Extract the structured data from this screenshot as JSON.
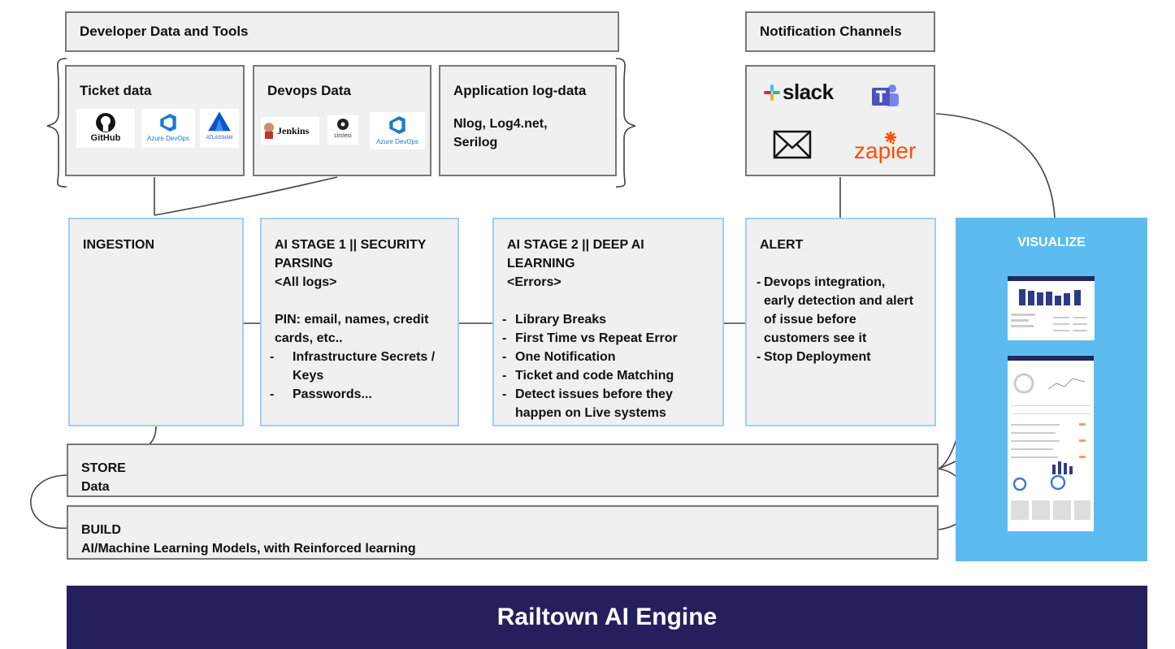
{
  "developer_header": "Developer Data and Tools",
  "notification_header": "Notification Channels",
  "ticket": {
    "title": "Ticket data",
    "logos": [
      "GitHub",
      "Azure DevOps",
      "ATLASSIAN"
    ]
  },
  "devops": {
    "title": "Devops Data",
    "logos": [
      "Jenkins",
      "circleci",
      "Azure DevOps"
    ]
  },
  "applog": {
    "title": "Application log-data",
    "lines": [
      "Nlog, Log4.net,",
      "Serilog"
    ]
  },
  "notifications": {
    "slack": "slack",
    "zapier": "zapier"
  },
  "ingestion": {
    "title": "INGESTION"
  },
  "stage1": {
    "title": "AI STAGE 1 || SECURITY\nPARSING\n<All logs>",
    "pin": "PIN: email, names, credit cards, etc..",
    "items": [
      "Infrastructure Secrets / Keys",
      "Passwords..."
    ]
  },
  "stage2": {
    "title": "AI STAGE 2 || DEEP AI\nLEARNING\n<Errors>",
    "items": [
      "Library Breaks",
      "First Time vs Repeat Error",
      "One Notification",
      "Ticket and code Matching",
      "Detect issues before they happen on Live systems"
    ]
  },
  "alert": {
    "title": "ALERT",
    "items": [
      "Devops integration, early detection and alert of issue before customers see it",
      "Stop Deployment"
    ]
  },
  "visualize": {
    "title": "VISUALIZE"
  },
  "store": {
    "title": "STORE",
    "subtitle": "Data"
  },
  "build": {
    "title": "BUILD",
    "subtitle": "AI/Machine Learning Models, with Reinforced learning"
  },
  "engine": {
    "title": "Railtown AI Engine"
  },
  "colors": {
    "visualize_bg": "#5cbcf0",
    "engine_bg": "#261f5e",
    "stage_border": "#9fd0ef",
    "zapier": "#ff4f00"
  }
}
